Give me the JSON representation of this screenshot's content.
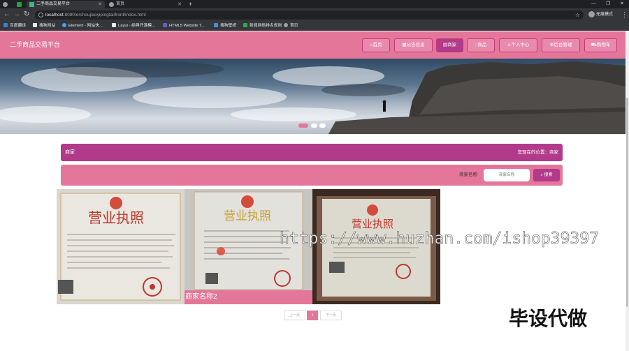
{
  "browser": {
    "tabs": [
      {
        "title": "二手商品交易平台"
      },
      {
        "title": "首页"
      }
    ],
    "url_host": "localhost",
    "url_path": ":8080/ershoujiaoyipingtai/front/index.html",
    "incognito_label": "无痕模式",
    "bookmarks": [
      "百度翻译",
      "搜狗网站",
      "Element - 网站快...",
      "Layui - 经典开源模...",
      "HTML5 Website T...",
      "搜狗壁纸",
      "新闻网络排名规则",
      "首页"
    ]
  },
  "site": {
    "title": "二手商品交易平台",
    "nav": [
      {
        "label": "⌂首页"
      },
      {
        "label": "▦公告信息"
      },
      {
        "label": "▤商家"
      },
      {
        "label": "◌商品"
      },
      {
        "label": "♙个人中心"
      },
      {
        "label": "⚙后台管理"
      },
      {
        "label": "⛟购物车"
      }
    ],
    "active_nav_index": 2,
    "section_title": "商家",
    "breadcrumb": "您现在的位置：商家",
    "search": {
      "label": "商家名称",
      "placeholder": "商家名称",
      "button": "搜索"
    },
    "cards": [
      {
        "name": "",
        "image": "business-license-1"
      },
      {
        "name": "商家名称2",
        "image": "business-license-2"
      },
      {
        "name": "",
        "image": "business-license-3"
      }
    ],
    "pagination": {
      "prev": "上一页",
      "current": "1",
      "next": "下一页"
    },
    "license_heading": "营业执照"
  },
  "overlay": {
    "watermark": "https://www.huzhan.com/ishop39397",
    "caption": "毕设代做"
  },
  "colors": {
    "header": "#e4769a",
    "accent": "#b23a8a"
  }
}
